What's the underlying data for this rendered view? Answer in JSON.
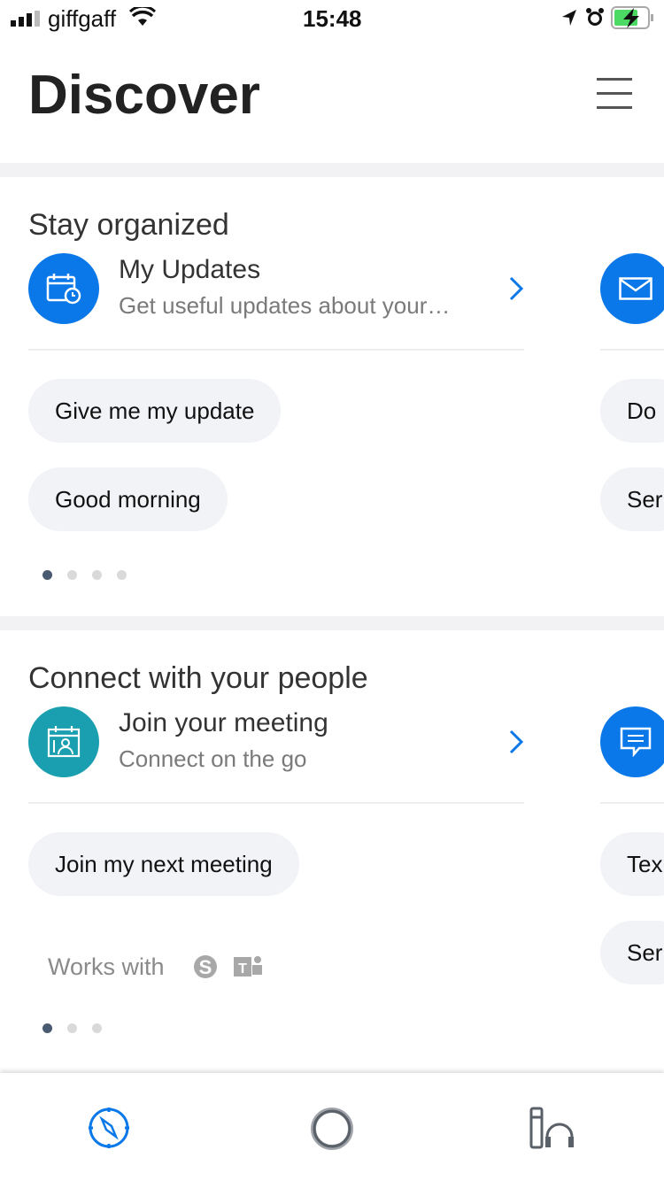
{
  "status_bar": {
    "carrier": "giffgaff",
    "time": "15:48",
    "icons": [
      "signal-icon",
      "wifi-icon",
      "location-icon",
      "alarm-icon",
      "battery-charging-icon"
    ]
  },
  "header": {
    "title": "Discover",
    "menu_icon": "hamburger-icon"
  },
  "cards": [
    {
      "title": "Stay organized",
      "item": {
        "title": "My Updates",
        "subtitle": "Get useful updates about your…",
        "icon": "calendar-clock-icon",
        "color": "#0a78e8"
      },
      "chips": [
        "Give me my update",
        "Good morning"
      ],
      "next": {
        "icon": "mail-icon",
        "chips": [
          "Do",
          "Ser"
        ]
      },
      "pages": 4,
      "current_page": 1
    },
    {
      "title": "Connect with your people",
      "item": {
        "title": "Join your meeting",
        "subtitle": "Connect on the go",
        "icon": "meeting-icon",
        "color": "#1a9fb0"
      },
      "chips": [
        "Join my next meeting"
      ],
      "works_with": "Works with",
      "works_icons": [
        "skype-icon",
        "teams-icon"
      ],
      "next": {
        "icon": "chat-icon",
        "chips": [
          "Tex",
          "Ser"
        ]
      },
      "pages": 3,
      "current_page": 1
    }
  ],
  "tabbar": {
    "items": [
      {
        "name": "discover",
        "icon": "compass-icon",
        "active": true
      },
      {
        "name": "cortana",
        "icon": "circle-icon"
      },
      {
        "name": "notebook",
        "icon": "notebook-headphones-icon"
      }
    ]
  },
  "colors": {
    "accent": "#0a78e8",
    "teal": "#1a9fb0",
    "chip_bg": "#f2f3f7"
  }
}
